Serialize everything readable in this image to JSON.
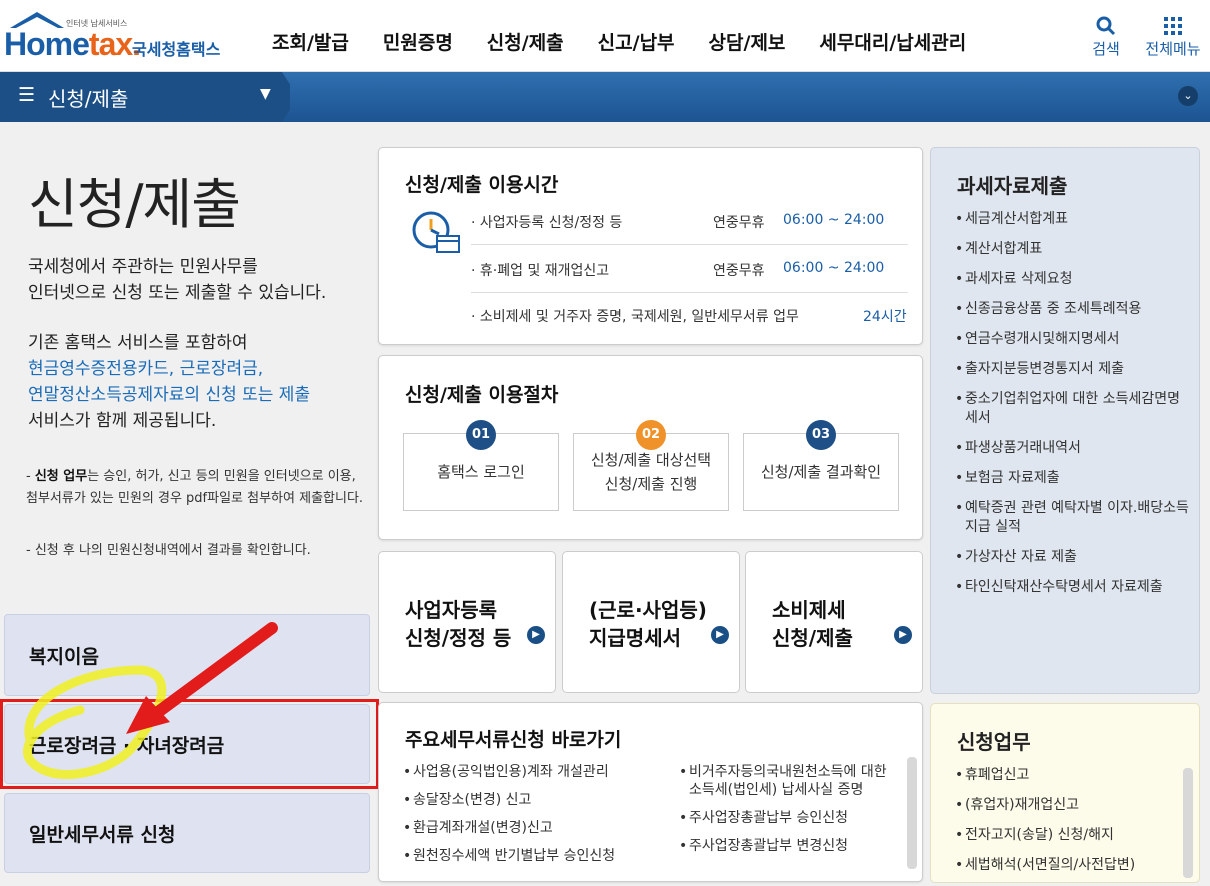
{
  "header": {
    "logo_small": "인터넷 납세서비스",
    "logo_brand_home": "Home",
    "logo_brand_tax": "tax.",
    "logo_korean": "국세청홈택스",
    "nav": [
      "조회/발급",
      "민원증명",
      "신청/제출",
      "신고/납부",
      "상담/제보",
      "세무대리/납세관리"
    ],
    "search_label": "검색",
    "menu_label": "전체메뉴"
  },
  "breadcrumb": {
    "title": "신청/제출"
  },
  "left": {
    "title": "신청/제출",
    "desc1_line1": "국세청에서 주관하는 민원사무를",
    "desc1_line2": "인터넷으로 신청 또는 제출할 수 있습니다.",
    "desc2_line1": "기존 홈택스 서비스를 포함하여",
    "desc2_link1": "현금영수증전용카드, 근로장려금,",
    "desc2_link2": "연말정산소득공제자료의 신청 또는 제출",
    "desc2_line4": "서비스가 함께 제공됩니다.",
    "note1_bold": "신청 업무",
    "note1_rest": "는 승인, 허가, 신고 등의 민원을 인터넷으로 이용, 첨부서류가 있는 민원의 경우 pdf파일로 첨부하여 제출합니다.",
    "note2": "신청 후 나의 민원신청내역에서 결과를 확인합니다.",
    "buttons": [
      "복지이음",
      "근로장려금 · 자녀장려금",
      "일반세무서류 신청"
    ]
  },
  "hours": {
    "title": "신청/제출 이용시간",
    "rows": [
      {
        "label": "사업자등록 신청/정정 등",
        "prefix": "연중무휴",
        "time": "06:00 ~ 24:00"
      },
      {
        "label": "휴·폐업 및 재개업신고",
        "prefix": "연중무휴",
        "time": "06:00 ~ 24:00"
      },
      {
        "label": "소비제세 및 거주자 증명, 국제세원, 일반세무서류 업무",
        "prefix": "",
        "time": "24시간"
      }
    ]
  },
  "procedure": {
    "title": "신청/제출 이용절차",
    "steps": [
      {
        "num": "01",
        "line1": "홈택스 로그인",
        "line2": ""
      },
      {
        "num": "02",
        "line1": "신청/제출 대상선택",
        "line2": "신청/제출 진행"
      },
      {
        "num": "03",
        "line1": "신청/제출 결과확인",
        "line2": ""
      }
    ]
  },
  "tiles": [
    {
      "line1": "사업자등록",
      "line2": "신청/정정 등"
    },
    {
      "line1": "(근로·사업등)",
      "line2": "지급명세서"
    },
    {
      "line1": "소비제세",
      "line2": "신청/제출"
    }
  ],
  "major": {
    "title": "주요세무서류신청 바로가기",
    "col1": [
      "사업용(공익법인용)계좌 개설관리",
      "송달장소(변경) 신고",
      "환급계좌개설(변경)신고",
      "원천징수세액 반기별납부 승인신청"
    ],
    "col2": [
      "비거주자등의국내원천소득에 대한 소득세(법인세) 납세사실 증명",
      "주사업장총괄납부 승인신청",
      "주사업장총괄납부 변경신청"
    ]
  },
  "tax_data": {
    "title": "과세자료제출",
    "items": [
      "세금계산서합계표",
      "계산서합계표",
      "과세자료 삭제요청",
      "신종금융상품 중 조세특례적용",
      "연금수령개시및해지명세서",
      "출자지분등변경통지서 제출",
      "중소기업취업자에 대한 소득세감면명세서",
      "파생상품거래내역서",
      "보험금 자료제출",
      "예탁증권 관련 예탁자별 이자.배당소득 지급 실적",
      "가상자산 자료 제출",
      "타인신탁재산수탁명세서 자료제출"
    ]
  },
  "apply_work": {
    "title": "신청업무",
    "items": [
      "휴폐업신고",
      "(휴업자)재개업신고",
      "전자고지(송달) 신청/해지",
      "세법해석(서면질의/사전답변)"
    ]
  },
  "colors": {
    "brand_blue": "#1a5ea8",
    "accent_orange": "#e8641b",
    "highlight_red": "#e21b1b",
    "marker_yellow": "#f0f020"
  }
}
